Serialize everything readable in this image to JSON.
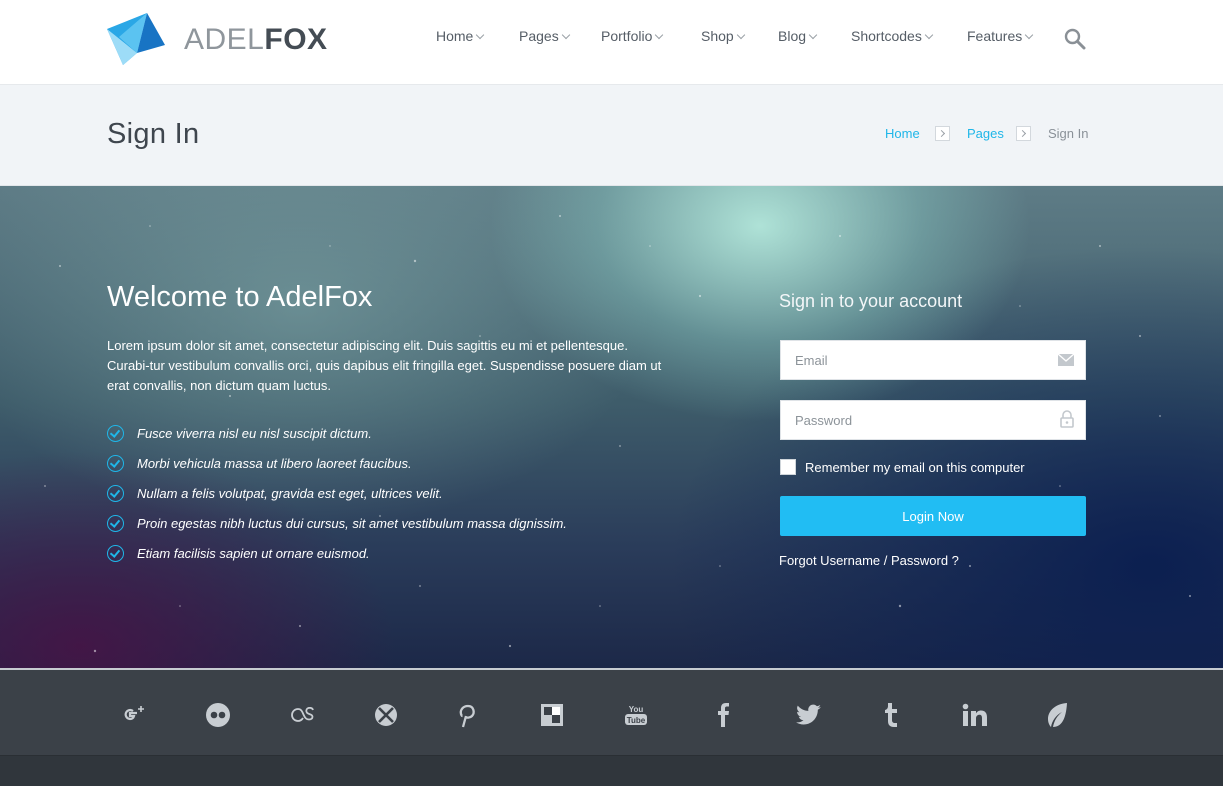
{
  "header": {
    "logo_light": "ADEL",
    "logo_bold": "FOX",
    "nav": [
      {
        "label": "Home",
        "icon": "chevron-down-icon"
      },
      {
        "label": "Pages",
        "icon": "chevron-down-icon"
      },
      {
        "label": "Portfolio",
        "icon": "chevron-down-icon"
      },
      {
        "label": "Shop",
        "icon": "chevron-down-icon"
      },
      {
        "label": "Blog",
        "icon": "chevron-down-icon"
      },
      {
        "label": "Shortcodes",
        "icon": "chevron-down-icon"
      },
      {
        "label": "Features",
        "icon": "chevron-down-icon"
      }
    ],
    "search_icon": "search-icon"
  },
  "titlebar": {
    "title": "Sign In",
    "breadcrumb": [
      "Home",
      "Pages",
      "Sign In"
    ]
  },
  "hero": {
    "welcome": "Welcome to AdelFox",
    "intro": "Lorem ipsum dolor sit amet, consectetur adipiscing elit. Duis sagittis eu mi et pellentesque. Curabi-tur vestibulum convallis orci, quis dapibus elit fringilla eget. Suspendisse posuere diam ut erat convallis, non dictum quam luctus.",
    "features": [
      "Fusce viverra nisl eu nisl suscipit dictum.",
      "Morbi vehicula massa ut libero laoreet faucibus.",
      "Nullam a felis volutpat, gravida est eget, ultrices velit.",
      "Proin egestas nibh luctus dui cursus, sit amet vestibulum massa dignissim.",
      "Etiam facilisis sapien ut ornare euismod."
    ]
  },
  "signin": {
    "title": "Sign in to your account",
    "email_placeholder": "Email",
    "email_value": "",
    "password_placeholder": "Password",
    "password_value": "",
    "remember_label": "Remember my email on this computer",
    "remember_checked": false,
    "login_label": "Login Now",
    "forgot_label": "Forgot Username / Password ?"
  },
  "footer": {
    "social_icons": [
      "google-plus-icon",
      "flickr-icon",
      "lastfm-icon",
      "xbox-icon",
      "pinterest-icon",
      "delicious-icon",
      "youtube-icon",
      "facebook-icon",
      "twitter-icon",
      "tumblr-icon",
      "linkedin-icon",
      "evernote-icon"
    ]
  },
  "colors": {
    "accent": "#21bdf3",
    "link": "#1fb6e8",
    "footer_bg": "#3b4148"
  }
}
